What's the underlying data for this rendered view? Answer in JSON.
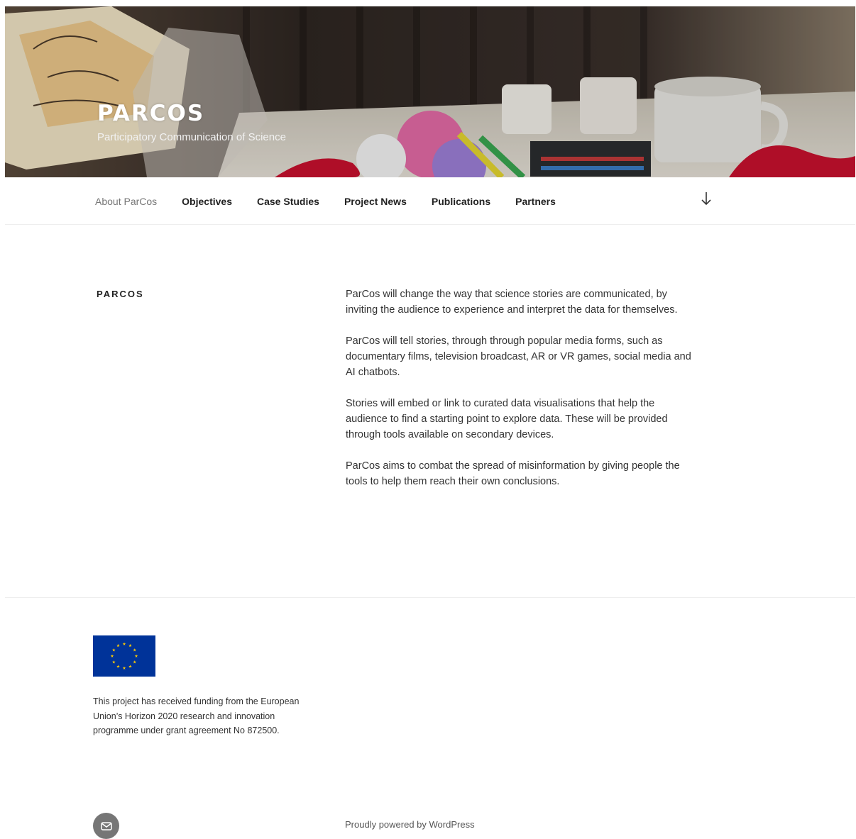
{
  "site": {
    "title": "PARCOS",
    "description": "Participatory Communication of Science"
  },
  "nav": {
    "items": [
      {
        "label": "About ParCos",
        "current": true
      },
      {
        "label": "Objectives"
      },
      {
        "label": "Case Studies"
      },
      {
        "label": "Project News"
      },
      {
        "label": "Publications"
      },
      {
        "label": "Partners"
      }
    ],
    "scroll_icon": "arrow-down-icon"
  },
  "page": {
    "heading": "PARCOS",
    "paragraphs": [
      "ParCos will change the way that science stories are communicated, by inviting the audience to experience and interpret the data for themselves.",
      "ParCos will tell stories, through through popular media forms, such as documentary films, television broadcast, AR or VR games, social media and AI chatbots.",
      "Stories will embed or link to curated data visualisations that help the audience to find a starting point to explore data. These will be provided through tools available on secondary devices.",
      "ParCos aims to combat the spread of misinformation by giving people the tools to help them reach their own conclusions."
    ]
  },
  "footer": {
    "flag_icon": "eu-flag-icon",
    "funding_text": "This project has received funding from the European Union’s Horizon 2020 research and innovation programme under grant agreement No 872500.",
    "social_icon": "envelope-icon",
    "powered_by": "Proudly powered by WordPress"
  },
  "colors": {
    "nav_current": "#767676",
    "social_bg": "#767676",
    "eu_blue": "#003399",
    "eu_gold": "#ffcc00"
  }
}
